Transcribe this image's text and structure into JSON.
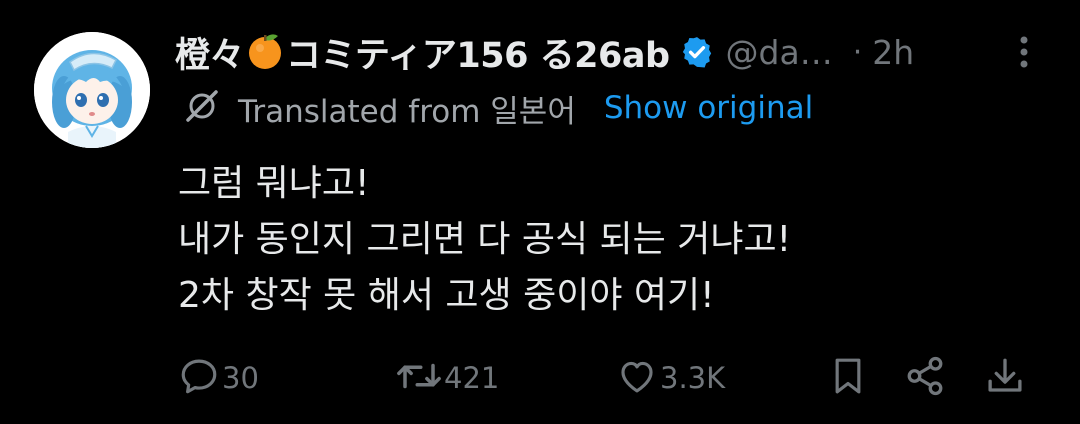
{
  "tweet": {
    "display_name": "橙々",
    "display_name_suffix": "コミティア156 る26ab",
    "handle": "@da…",
    "separator": "·",
    "timestamp": "2h",
    "translation": {
      "label": "Translated from 일본어",
      "show_original_label": "Show original"
    },
    "text_lines": [
      "그럼 뭐냐고!",
      "내가 동인지 그리면 다 공식 되는 거냐고!",
      "2차 창작 못 해서 고생 중이야 여기!"
    ],
    "stats": {
      "replies": "30",
      "reposts": "421",
      "likes": "3.3K"
    }
  },
  "colors": {
    "background": "#000000",
    "text_primary": "#e7e9ea",
    "text_secondary": "#71767b",
    "accent": "#1d9bf0"
  },
  "icons": {
    "name_emoji": "orange-emoji",
    "verified": "verified-badge-icon",
    "translate": "translate-icon",
    "more": "more-vertical-icon",
    "reply": "reply-icon",
    "repost": "repost-icon",
    "like": "heart-icon",
    "bookmark": "bookmark-icon",
    "share": "share-icon",
    "download": "download-icon"
  }
}
